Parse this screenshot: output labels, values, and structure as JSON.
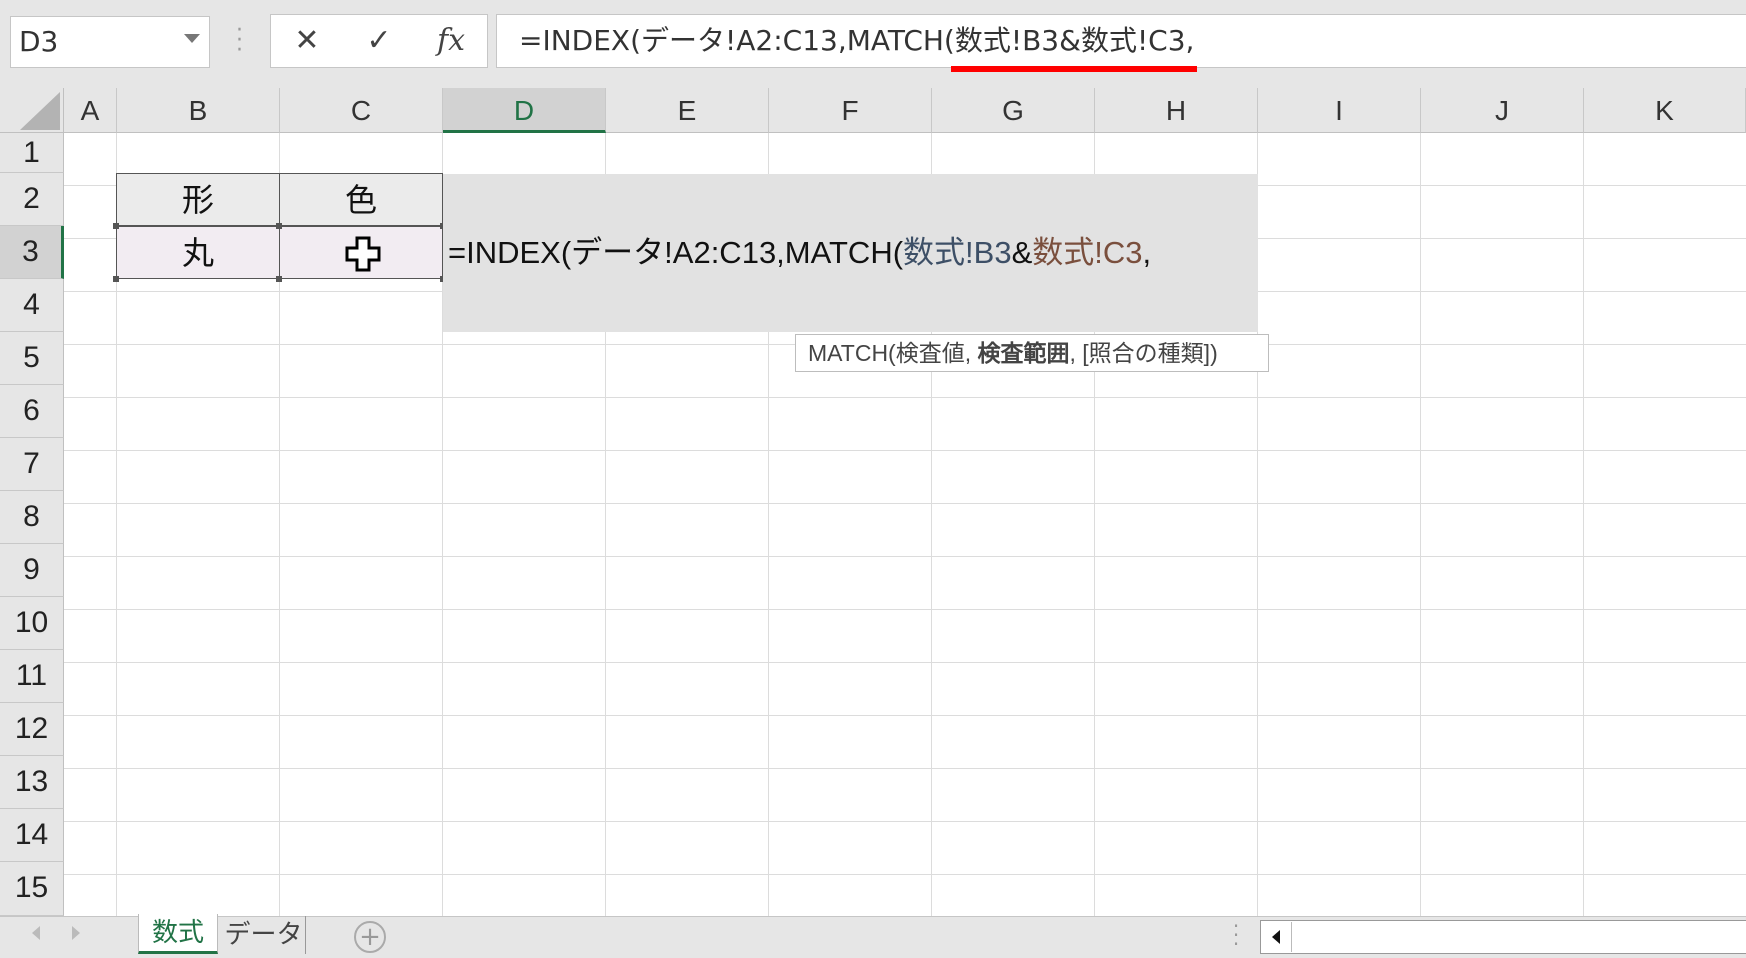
{
  "formula_bar": {
    "name_box": "D3",
    "cancel_icon": "✕",
    "enter_icon": "✓",
    "fx_label": "fx",
    "formula": "=INDEX(データ!A2:C13,MATCH(数式!B3&数式!C3,"
  },
  "columns": [
    "A",
    "B",
    "C",
    "D",
    "E",
    "F",
    "G",
    "H",
    "I",
    "J",
    "K"
  ],
  "rows": [
    "1",
    "2",
    "3",
    "4",
    "5",
    "6",
    "7",
    "8",
    "9",
    "10",
    "11",
    "12",
    "13",
    "14",
    "15"
  ],
  "cells": {
    "b2": "形",
    "c2": "色",
    "b3": "丸",
    "c3": ""
  },
  "edit": {
    "part1": "=INDEX(データ!A2:C13,MATCH(",
    "ref_b": "数式!B3",
    "amp": "&",
    "ref_c": "数式!C3",
    "tail": ","
  },
  "tooltip": {
    "prefix": "MATCH(検査値, ",
    "current_arg": "検査範囲",
    "suffix": ", [照合の種類])"
  },
  "sheets": {
    "active": "数式",
    "other": "データ",
    "add_icon": "+"
  },
  "colors": {
    "accent": "#217346",
    "underline": "#ff0000"
  }
}
